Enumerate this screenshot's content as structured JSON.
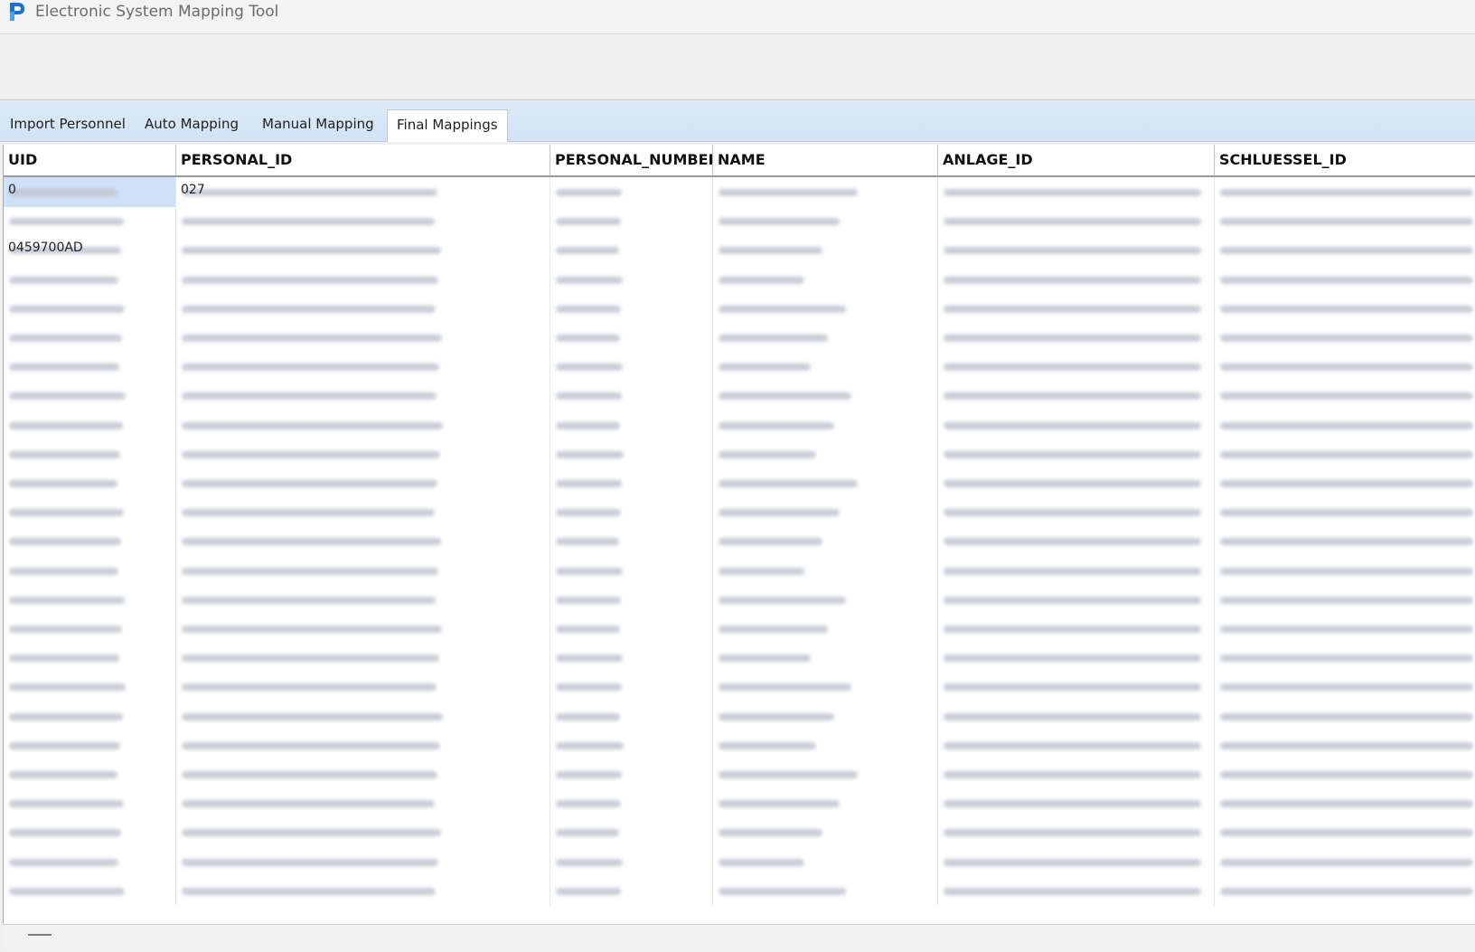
{
  "app": {
    "title": "Electronic System Mapping Tool"
  },
  "tabs": [
    {
      "label": "Import Personnel",
      "active": false
    },
    {
      "label": "Auto Mapping",
      "active": false
    },
    {
      "label": "Manual Mapping",
      "active": false
    },
    {
      "label": "Final Mappings",
      "active": true
    }
  ],
  "table": {
    "columns": [
      "UID",
      "PERSONAL_ID",
      "PERSONAL_NUMBER",
      "NAME",
      "ANLAGE_ID",
      "SCHLUESSEL_ID"
    ],
    "visible_text": {
      "row_1_uid": "0",
      "row_1_personal_id": "027",
      "row_3_uid": "0459700AD"
    },
    "row_count": 25,
    "selected_row": 1,
    "values_redacted": true
  },
  "colors": {
    "accent_tab_strip": "#d3e3f5",
    "selection": "#cfe0f7",
    "app_icon": "#1f6fd1"
  }
}
